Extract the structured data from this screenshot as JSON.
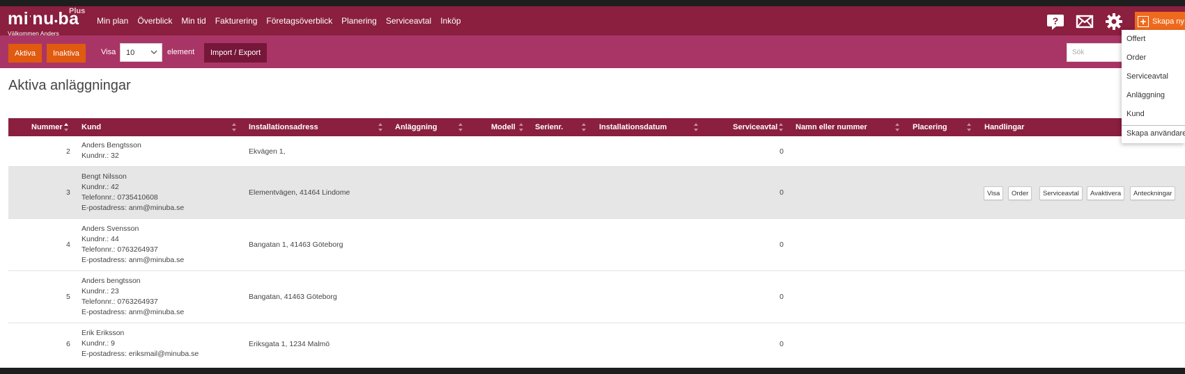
{
  "logo": {
    "text": "mi|nu•ba",
    "plus": "Plus",
    "welcome": "Välkommen Anders"
  },
  "menu": [
    "Min plan",
    "Överblick",
    "Min tid",
    "Fakturering",
    "Företagsöverblick",
    "Planering",
    "Serviceavtal",
    "Inköp"
  ],
  "header_icons": [
    "help-icon",
    "mail-icon",
    "gear-icon"
  ],
  "skapa_label": "Skapa ny",
  "dropdown": [
    "Offert",
    "Order",
    "Serviceavtal",
    "Anläggning",
    "Kund",
    "Skapa användare"
  ],
  "toolbar": {
    "aktiva": "Aktiva",
    "inaktiva": "Inaktiva",
    "visa": "Visa",
    "page_size": "10",
    "element": "element",
    "import_export": "Import / Export",
    "search_placeholder": "Sök"
  },
  "page_title": "Aktiva anläggningar",
  "columns": [
    "Nummer",
    "Kund",
    "Installationsadress",
    "Anläggning",
    "Modell",
    "Serienr.",
    "Installationsdatum",
    "Serviceavtal",
    "Namn eller nummer",
    "Placering",
    "Handlingar"
  ],
  "rows": [
    {
      "nummer": "2",
      "kund": [
        "Anders Bengtsson",
        "Kundnr.: 32"
      ],
      "adress": "Ekvägen 1,",
      "serviceavtal": "0"
    },
    {
      "nummer": "3",
      "kund": [
        "Bengt Nilsson",
        "Kundnr.: 42",
        "Telefonnr.: 0735410608",
        "E-postadress: anm@minuba.se"
      ],
      "adress": "Elementvägen, 41464 Lindome",
      "serviceavtal": "0"
    },
    {
      "nummer": "4",
      "kund": [
        "Anders Svensson",
        "Kundnr.: 44",
        "Telefonnr.: 0763264937",
        "E-postadress: anm@minuba.se"
      ],
      "adress": "Bangatan 1, 41463 Göteborg",
      "serviceavtal": "0"
    },
    {
      "nummer": "5",
      "kund": [
        "Anders bengtsson",
        "Kundnr.: 23",
        "Telefonnr.: 0763264937",
        "E-postadress: anm@minuba.se"
      ],
      "adress": "Bangatan, 41463 Göteborg",
      "serviceavtal": "0"
    },
    {
      "nummer": "6",
      "kund": [
        "Erik Eriksson",
        "Kundnr.: 9",
        "E-postadress: eriksmail@minuba.se"
      ],
      "adress": "Eriksgata 1, 1234 Malmö",
      "serviceavtal": "0"
    }
  ],
  "row_actions": [
    "Visa",
    "Order",
    "Serviceavtal",
    "Avaktivera",
    "Anteckningar"
  ],
  "colors": {
    "primary": "#8a1f3f",
    "secondary": "#a93566",
    "accent": "#e05a0f",
    "hover_row": "#e6e6e6"
  }
}
